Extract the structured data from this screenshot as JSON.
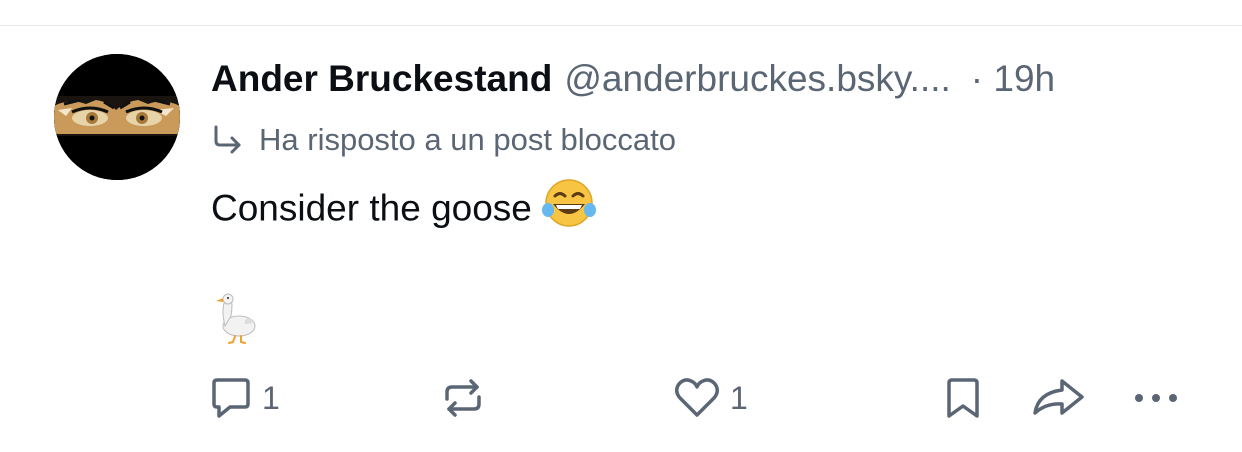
{
  "post": {
    "author_name": "Ander Bruckestand",
    "author_handle": "@anderbruckes.bsky....",
    "time": "· 19h",
    "reply_context": "Ha risposto a un post bloccato",
    "text_line_1": "Consider the goose",
    "emoji_1": "laughing-crying-face",
    "emoji_2": "goose"
  },
  "actions": {
    "reply_count": "1",
    "like_count": "1",
    "icons": {
      "reply": "speech-bubble-icon",
      "repost": "repost-arrows-icon",
      "like": "heart-icon",
      "bookmark": "bookmark-icon",
      "share": "share-arrow-icon",
      "more": "ellipsis-icon"
    }
  },
  "colors": {
    "text_primary": "#0b0f14",
    "text_secondary": "#5b6675",
    "divider": "#e6e8eb"
  }
}
